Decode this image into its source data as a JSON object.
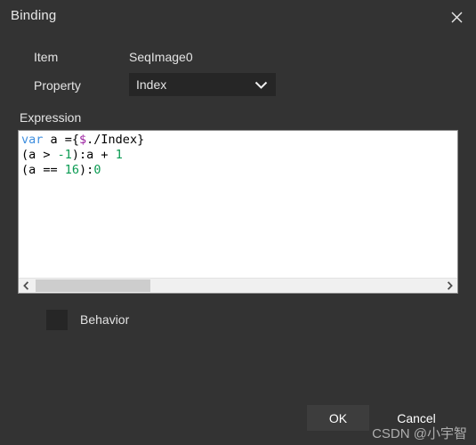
{
  "window": {
    "title": "Binding",
    "close_icon": "close-icon"
  },
  "form": {
    "item_label": "Item",
    "item_value": "SeqImage0",
    "property_label": "Property",
    "property_value": "Index",
    "property_dropdown_icon": "chevron-down-icon"
  },
  "expression": {
    "label": "Expression",
    "lines": [
      {
        "parts": [
          {
            "text": "var",
            "token": "keyword"
          },
          {
            "text": " a ={",
            "token": "plain"
          },
          {
            "text": "$",
            "token": "variable"
          },
          {
            "text": "./Index}",
            "token": "plain"
          }
        ]
      },
      {
        "parts": [
          {
            "text": "(a > ",
            "token": "plain"
          },
          {
            "text": "-1",
            "token": "number"
          },
          {
            "text": "):a + ",
            "token": "plain"
          },
          {
            "text": "1",
            "token": "number"
          }
        ]
      },
      {
        "parts": [
          {
            "text": "(a == ",
            "token": "plain"
          },
          {
            "text": "16",
            "token": "number"
          },
          {
            "text": "):",
            "token": "plain"
          },
          {
            "text": "0",
            "token": "number"
          }
        ]
      }
    ],
    "raw_text": "var a ={$./Index}\n(a > -1):a + 1\n(a == 16):0",
    "scrollbar": {
      "left_arrow_icon": "chevron-left-icon",
      "right_arrow_icon": "chevron-right-icon",
      "thumb_position_percent": 0,
      "thumb_width_percent": 28
    }
  },
  "behavior": {
    "label": "Behavior",
    "checked": false
  },
  "buttons": {
    "ok": "OK",
    "cancel": "Cancel"
  },
  "watermark": {
    "text": "CSDN @小宇智"
  },
  "colors": {
    "dialog_background": "#333333",
    "field_background": "#262626",
    "editor_background": "#ffffff",
    "keyword": "#3f8fdf",
    "variable": "#9b1fa0",
    "number": "#0a9b52",
    "text": "#e4e4e4"
  }
}
